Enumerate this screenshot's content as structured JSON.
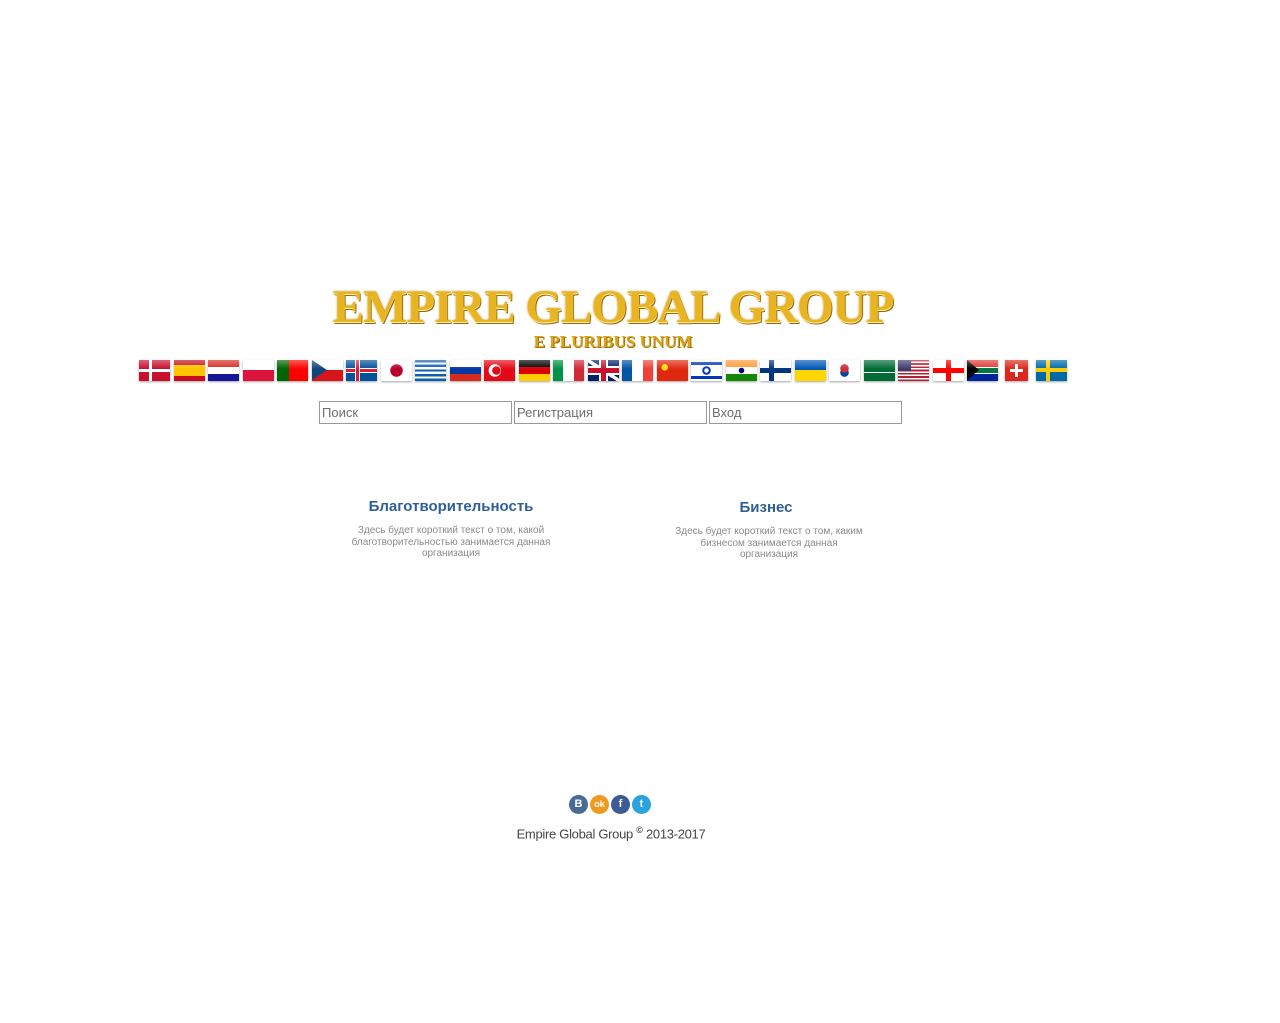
{
  "header": {
    "title": "EMPIRE GLOBAL GROUP",
    "motto": "E PLURIBUS UNUM"
  },
  "languages": [
    {
      "icon": "flag-denmark"
    },
    {
      "icon": "flag-spain"
    },
    {
      "icon": "flag-croatia"
    },
    {
      "icon": "flag-poland"
    },
    {
      "icon": "flag-portugal"
    },
    {
      "icon": "flag-czech"
    },
    {
      "icon": "flag-iceland"
    },
    {
      "icon": "flag-japan"
    },
    {
      "icon": "flag-greece"
    },
    {
      "icon": "flag-russia"
    },
    {
      "icon": "flag-turkey"
    },
    {
      "icon": "flag-germany"
    },
    {
      "icon": "flag-italy"
    },
    {
      "icon": "flag-uk"
    },
    {
      "icon": "flag-france"
    },
    {
      "icon": "flag-china"
    },
    {
      "icon": "flag-israel"
    },
    {
      "icon": "flag-india"
    },
    {
      "icon": "flag-finland"
    },
    {
      "icon": "flag-ukraine"
    },
    {
      "icon": "flag-south-korea"
    },
    {
      "icon": "flag-saudi-arabia"
    },
    {
      "icon": "flag-usa"
    },
    {
      "icon": "flag-georgia"
    },
    {
      "icon": "flag-south-africa"
    },
    {
      "icon": "flag-switzerland"
    },
    {
      "icon": "flag-sweden"
    }
  ],
  "nav": {
    "search_placeholder": "Поиск",
    "register_placeholder": "Регистрация",
    "login_placeholder": "Вход"
  },
  "sections": {
    "charity": {
      "title": "Благотворительность",
      "line1": "Здесь будет короткий текст о том, какой",
      "line2": "благотворительностью занимается данная",
      "line3": "организация"
    },
    "business": {
      "title": "Бизнес",
      "line1": "Здесь будет короткий текст о том, каким",
      "line2": "бизнесом занимается данная",
      "line3": "организация"
    }
  },
  "social": {
    "vk": {
      "label": "В",
      "icon": "vk-icon",
      "color": "#4a6a96"
    },
    "ok": {
      "label": "ok",
      "icon": "odnoklassniki-icon",
      "color": "#f09a22"
    },
    "fb": {
      "label": "f",
      "icon": "facebook-icon",
      "color": "#3b5b96"
    },
    "tw": {
      "label": "t",
      "icon": "twitter-icon",
      "color": "#2aa3df"
    }
  },
  "footer": {
    "name": "Empire Global Group",
    "symbol": "©",
    "years": "2013-2017"
  }
}
